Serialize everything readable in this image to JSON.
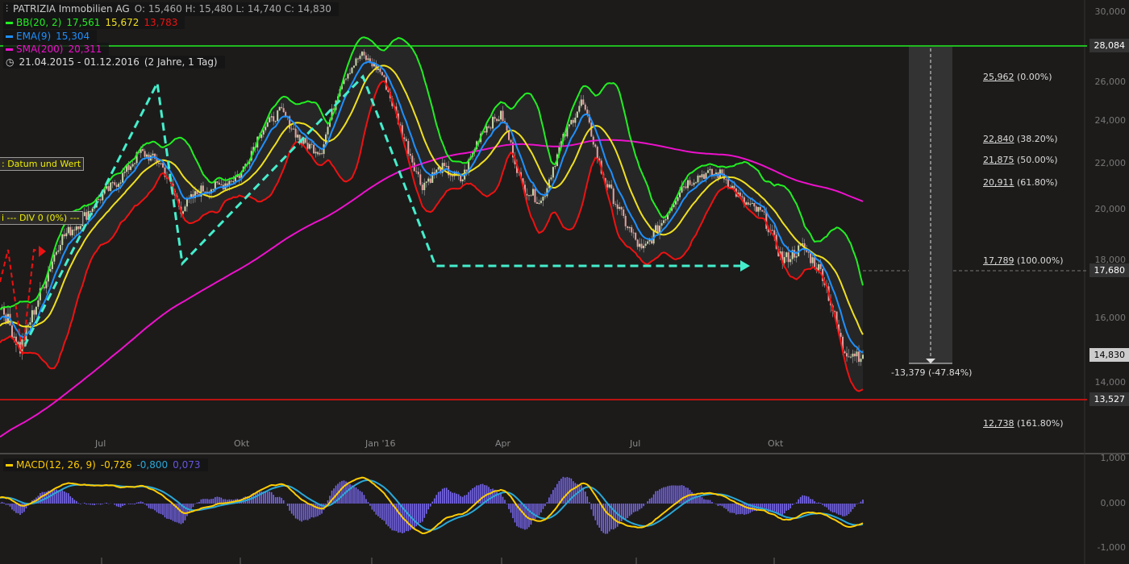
{
  "header": {
    "instrument": "PATRIZIA Immobilien AG",
    "ohlc": "O: 15,460  H: 15,480  L: 14,740  C: 14,830",
    "bb_label": "BB(20, 2)",
    "bb_upper": "17,561",
    "bb_mid": "15,672",
    "bb_lower": "13,783",
    "ema_label": "EMA(9)",
    "ema_value": "15,304",
    "sma_label": "SMA(200)",
    "sma_value": "20,311",
    "range": "21.04.2015 - 01.12.2016",
    "range_span": "(2 Jahre, 1 Tag)"
  },
  "macd_legend": {
    "label": "MACD(12, 26, 9)",
    "macd": "-0,726",
    "signal": "-0,800",
    "hist": "0,073"
  },
  "price_axis": [
    "30,000",
    "26,000",
    "24,000",
    "22,000",
    "20,000",
    "18,000",
    "16,000",
    "14,000"
  ],
  "macd_axis": [
    "1,000",
    "0,000",
    "-1,000"
  ],
  "time_axis": [
    "Jul",
    "Okt",
    "Jan '16",
    "Apr",
    "Jul",
    "Okt"
  ],
  "price_tags": {
    "resistance": "28,084",
    "dashed": "17,680",
    "last": "14,830",
    "support": "13,527"
  },
  "fib_levels": [
    {
      "value": "25,962",
      "pct": "(0.00%)"
    },
    {
      "value": "22,840",
      "pct": "(38.20%)"
    },
    {
      "value": "21,875",
      "pct": "(50.00%)"
    },
    {
      "value": "20,911",
      "pct": "(61.80%)"
    },
    {
      "value": "17,789",
      "pct": "(100.00%)"
    },
    {
      "value": "12,738",
      "pct": "(161.80%)"
    }
  ],
  "measure_label": "-13,379 (-47.84%)",
  "side_labels": {
    "datum": ": Datum und Wert",
    "div": "i --- DIV 0 (0%) ---"
  },
  "colors": {
    "bb_upper": "#22ee22",
    "bb_mid": "#f0e020",
    "bb_lower": "#ee1111",
    "ema": "#1e90ff",
    "sma": "#ee11cc",
    "macd": "#ffcc00",
    "signal": "#2aa8d8",
    "hist": "#7766ee"
  },
  "chart_data": {
    "type": "candlestick",
    "title": "PATRIZIA Immobilien AG",
    "x_range": [
      "21.04.2015",
      "01.12.2016"
    ],
    "sampling": "approx. bi-weekly closes",
    "closes": [
      16.5,
      15,
      16.8,
      18.8,
      19.5,
      20.5,
      21.3,
      22.5,
      22,
      20,
      20.8,
      21,
      21.5,
      23.5,
      24.5,
      23,
      22.5,
      26,
      27.5,
      26.5,
      23.5,
      21,
      21.8,
      21.2,
      23.5,
      24.3,
      21,
      20.3,
      23,
      25,
      21.5,
      19.7,
      18.3,
      19.5,
      21,
      21.5,
      21.5,
      20.3,
      19.8,
      18,
      18.5,
      17.5,
      15,
      14.83
    ],
    "ylim": [
      12,
      30
    ],
    "yscale": "log",
    "macd_ylim": [
      -1.1,
      1.1
    ]
  }
}
